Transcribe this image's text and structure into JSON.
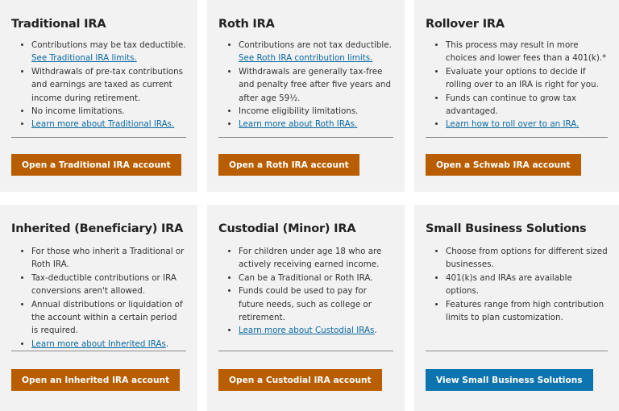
{
  "colors": {
    "card_bg": "#f2f2f2",
    "button_orange": "#b85d00",
    "button_blue": "#0e74b0",
    "link": "#0b6aa2"
  },
  "cards": [
    {
      "title": "Traditional IRA",
      "bullets": [
        {
          "text": "Contributions may be tax deductible.",
          "link": "See Traditional IRA limits."
        },
        {
          "text": "Withdrawals of pre-tax contributions and earnings are taxed as current income during retirement."
        },
        {
          "text": "No income limitations."
        },
        {
          "link": "Learn more about Traditional IRAs."
        }
      ],
      "button": "Open a Traditional IRA account"
    },
    {
      "title": "Roth IRA",
      "bullets": [
        {
          "text": "Contributions are not tax deductible.",
          "link": "See Roth IRA contribution limits."
        },
        {
          "text": "Withdrawals are generally tax-free and penalty free after five years and after age 59½."
        },
        {
          "text": "Income eligibility limitations."
        },
        {
          "link": "Learn more about Roth IRAs."
        }
      ],
      "button": "Open a Roth IRA account"
    },
    {
      "title": "Rollover IRA",
      "bullets": [
        {
          "text": "This process may result in more choices and lower fees than a 401(k).*"
        },
        {
          "text": "Evaluate your options to decide if rolling over to an IRA is right for you."
        },
        {
          "text": "Funds can continue to grow tax advantaged."
        },
        {
          "link": "Learn how to roll over to an IRA."
        }
      ],
      "button": "Open a Schwab IRA account"
    },
    {
      "title": "Inherited (Beneficiary) IRA",
      "bullets": [
        {
          "text": "For those who inherit a Traditional or Roth IRA."
        },
        {
          "text": "Tax-deductible contributions or IRA conversions aren't allowed."
        },
        {
          "text": "Annual distributions or liquidation of the account within a certain period is required."
        },
        {
          "link": "Learn more about Inherited IRAs",
          "after": "."
        }
      ],
      "button": "Open an Inherited IRA account"
    },
    {
      "title": "Custodial (Minor) IRA",
      "bullets": [
        {
          "text": "For children under age 18 who are actively receiving earned income."
        },
        {
          "text": "Can be a Traditional or Roth IRA."
        },
        {
          "text": "Funds could be used to pay for future needs, such as college or retirement."
        },
        {
          "link": "Learn more about Custodial IRAs",
          "after": "."
        }
      ],
      "button": "Open a Custodial IRA account"
    },
    {
      "title": "Small Business Solutions",
      "bullets": [
        {
          "text": "Choose from options for different sized businesses."
        },
        {
          "text": "401(k)s and IRAs are available options."
        },
        {
          "text": "Features range from high contribution limits to plan customization."
        }
      ],
      "button": "View Small Business Solutions"
    }
  ]
}
